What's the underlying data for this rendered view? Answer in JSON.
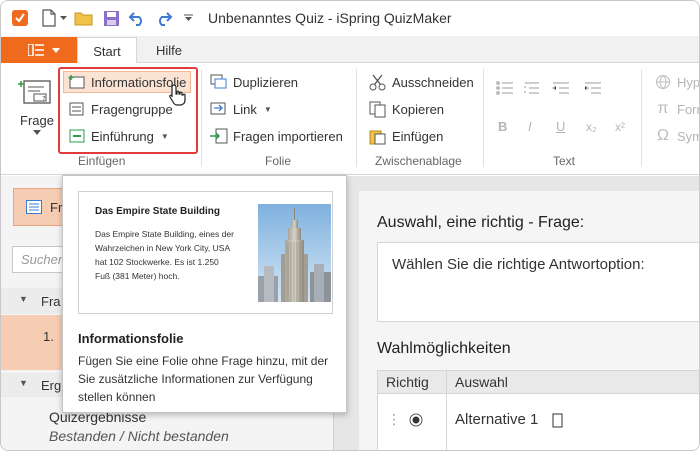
{
  "window": {
    "title": "Unbenanntes Quiz - iSpring QuizMaker"
  },
  "tabs": [
    {
      "label": "Start",
      "active": true
    },
    {
      "label": "Hilfe",
      "active": false
    }
  ],
  "ribbon": {
    "frage_label": "Frage",
    "einfuegen": {
      "label": "Einfügen",
      "items": [
        "Informationsfolie",
        "Fragengruppe",
        "Einführung"
      ]
    },
    "folie": {
      "label": "Folie",
      "items": [
        "Duplizieren",
        "Link",
        "Fragen importieren"
      ]
    },
    "zwischenablage": {
      "label": "Zwischenablage",
      "items": [
        "Ausschneiden",
        "Kopieren",
        "Einfügen"
      ]
    },
    "text": {
      "label": "Text",
      "sub": "x₂",
      "sup": "x²"
    },
    "extra": [
      "Hyp",
      "Forr",
      "Sym"
    ]
  },
  "left": {
    "button_label": "Fr",
    "search_placeholder": "Suchen",
    "tree": {
      "group1": "Fra",
      "item1_num": "1.",
      "group2": "Erg",
      "results_title": "Quizergebnisse",
      "results_sub": "Bestanden / Nicht bestanden"
    }
  },
  "main": {
    "question_title": "Auswahl, eine richtig - Frage:",
    "question_text": "Wählen Sie die richtige Antwortoption:",
    "choices_title": "Wahlmöglichkeiten",
    "col_correct": "Richtig",
    "col_choice": "Auswahl",
    "alternative1": "Alternative 1"
  },
  "tooltip": {
    "card_title": "Das Empire State Building",
    "card_text": "Das Empire State Building, eines der Wahrzeichen in New York City, USA hat 102 Stockwerke. Es ist 1.250 Fuß (381 Meter) hoch.",
    "title": "Informationsfolie",
    "description": "Fügen Sie eine Folie ohne Frage hinzu, mit der Sie zusätzliche Informationen zur Verfügung stellen können"
  },
  "colors": {
    "accent": "#ef6a1c",
    "highlight": "#e23b3b",
    "blue_icon": "#3c7bd4"
  }
}
